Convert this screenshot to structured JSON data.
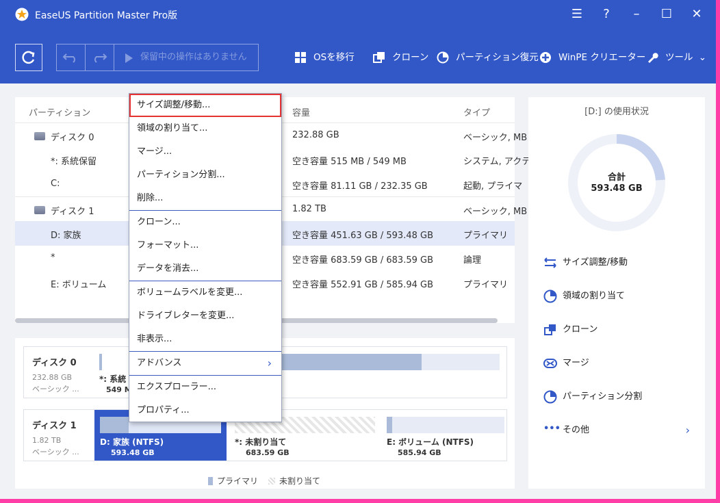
{
  "window": {
    "title": "EaseUS Partition Master Pro版"
  },
  "toolbar": {
    "pending": "保留中の操作はありません",
    "tools": [
      "OSを移行",
      "クローン",
      "パーティション復元",
      "WinPE クリエーター",
      "ツール"
    ]
  },
  "table": {
    "headers": {
      "partition": "パーティション",
      "capacity": "容量",
      "type": "タイプ"
    },
    "rows": [
      {
        "name": "ディスク 0",
        "capacity": "232.88 GB",
        "type": "ベーシック, MB"
      },
      {
        "name": "*: 系統保留",
        "capacity": "空き容量 515 MB / 549 MB",
        "type": "システム, アクテ"
      },
      {
        "name": "C:",
        "capacity": "空き容量 81.11 GB / 232.35 GB",
        "type": "起動, プライマ"
      },
      {
        "name": "ディスク 1",
        "capacity": "1.82 TB",
        "type": "ベーシック, MB"
      },
      {
        "name": "D: 家族",
        "capacity": "空き容量 451.63 GB / 593.48 GB",
        "type": "プライマリ"
      },
      {
        "name": "*",
        "capacity": "空き容量 683.59 GB / 683.59 GB",
        "type": "論理"
      },
      {
        "name": "E: ボリューム",
        "capacity": "空き容量 552.91 GB / 585.94 GB",
        "type": "プライマリ"
      }
    ]
  },
  "diskmap": {
    "disk0": {
      "name": "ディスク 0",
      "size": "232.88 GB",
      "kind": "ベーシック ...",
      "part1_name": "*: 系統",
      "part1_size": "549 M",
      "fill_c": 0.65
    },
    "disk1": {
      "name": "ディスク 1",
      "size": "1.82 TB",
      "kind": "ベーシック ...",
      "parts": [
        {
          "name": "D: 家族 (NTFS)",
          "size": "593.48 GB"
        },
        {
          "name": "*: 未割り当て",
          "size": "683.59 GB"
        },
        {
          "name": "E: ボリューム (NTFS)",
          "size": "585.94 GB"
        }
      ]
    },
    "legend": {
      "primary": "プライマリ",
      "unallocated": "未割り当て"
    }
  },
  "usage": {
    "title": "[D:] の使用状況",
    "total_label": "合計",
    "total": "593.48 GB",
    "used_fraction": 0.24
  },
  "actions": [
    "サイズ調整/移動",
    "領域の割り当て",
    "クローン",
    "マージ",
    "パーティション分割",
    "その他"
  ],
  "context_menu": [
    "サイズ調整/移動...",
    "領域の割り当て...",
    "マージ...",
    "パーティション分割...",
    "削除...",
    "クローン...",
    "フォーマット...",
    "データを消去...",
    "ボリュームラベルを変更...",
    "ドライブレターを変更...",
    "非表示...",
    "アドバンス",
    "エクスプローラー...",
    "プロパティ..."
  ],
  "colors": {
    "brand_blue": "#3258c8",
    "highlight_red": "#e53333",
    "primary_bar": "#a9bbd9"
  }
}
